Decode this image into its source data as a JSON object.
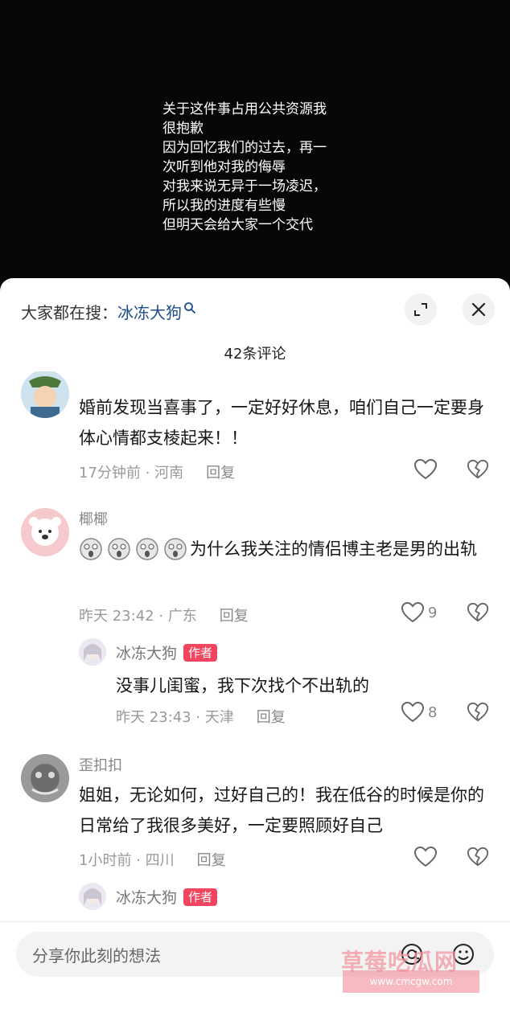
{
  "video": {
    "overlay_text": "关于这件事占用公共资源我\n很抱歉\n因为回忆我们的过去，再一\n次听到他对我的侮辱\n对我来说无异于一场凌迟，\n所以我的进度有些慢\n但明天会给大家一个交代"
  },
  "search": {
    "prefix": "大家都在搜：",
    "term": "冰冻大狗"
  },
  "comment_count": "42条评论",
  "comments": [
    {
      "username": "",
      "text": "婚前发现当喜事了，一定好好休息，咱们自己一定要身体心情都支棱起来！！",
      "time_loc": "17分钟前 · 河南",
      "reply_label": "回复",
      "likes": ""
    },
    {
      "username": "椰椰",
      "text": "为什么我关注的情侣博主老是男的出轨",
      "time_loc": "昨天 23:42 · 广东",
      "reply_label": "回复",
      "likes": "9",
      "reply": {
        "username": "冰冻大狗",
        "badge": "作者",
        "text": "没事儿闺蜜，我下次找个不出轨的",
        "time_loc": "昨天 23:43 · 天津",
        "reply_label": "回复",
        "likes": "8"
      }
    },
    {
      "username": "歪扣扣",
      "text": "姐姐，无论如何，过好自己的！我在低谷的时候是你的日常给了我很多美好，一定要照顾好自己",
      "time_loc": "1小时前 · 四川",
      "reply_label": "回复",
      "likes": "",
      "reply": {
        "username": "冰冻大狗",
        "badge": "作者"
      }
    }
  ],
  "input": {
    "placeholder": "分享你此刻的想法"
  },
  "watermark": {
    "text": "草莓吃瓜网",
    "url": "www.cmcgw.com"
  },
  "colors": {
    "author_badge": "#f2465f",
    "search_term": "#1f4e8c"
  }
}
